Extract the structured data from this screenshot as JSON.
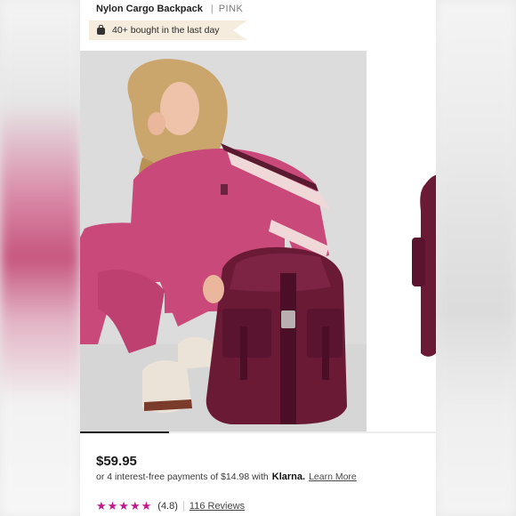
{
  "product": {
    "title": "Nylon Cargo Backpack",
    "separator": "|",
    "variant": "PINK"
  },
  "badge": {
    "icon": "shopping-bag-icon",
    "text": "40+ bought in the last day"
  },
  "gallery": {
    "active_index": 0,
    "scroll_position": 0.25
  },
  "pricing": {
    "price": "$59.95",
    "installments_prefix": "or 4 interest-free payments of $14.98 with",
    "provider": "Klarna.",
    "learn_more": "Learn More"
  },
  "rating": {
    "stars": "★★★★★",
    "score": "(4.8)",
    "reviews": "116 Reviews",
    "star_color": "#c2188f"
  },
  "colors": {
    "hoodie": "#c8497a",
    "backpack": "#6b1a36",
    "badge_bg": "#f6ecdd"
  }
}
